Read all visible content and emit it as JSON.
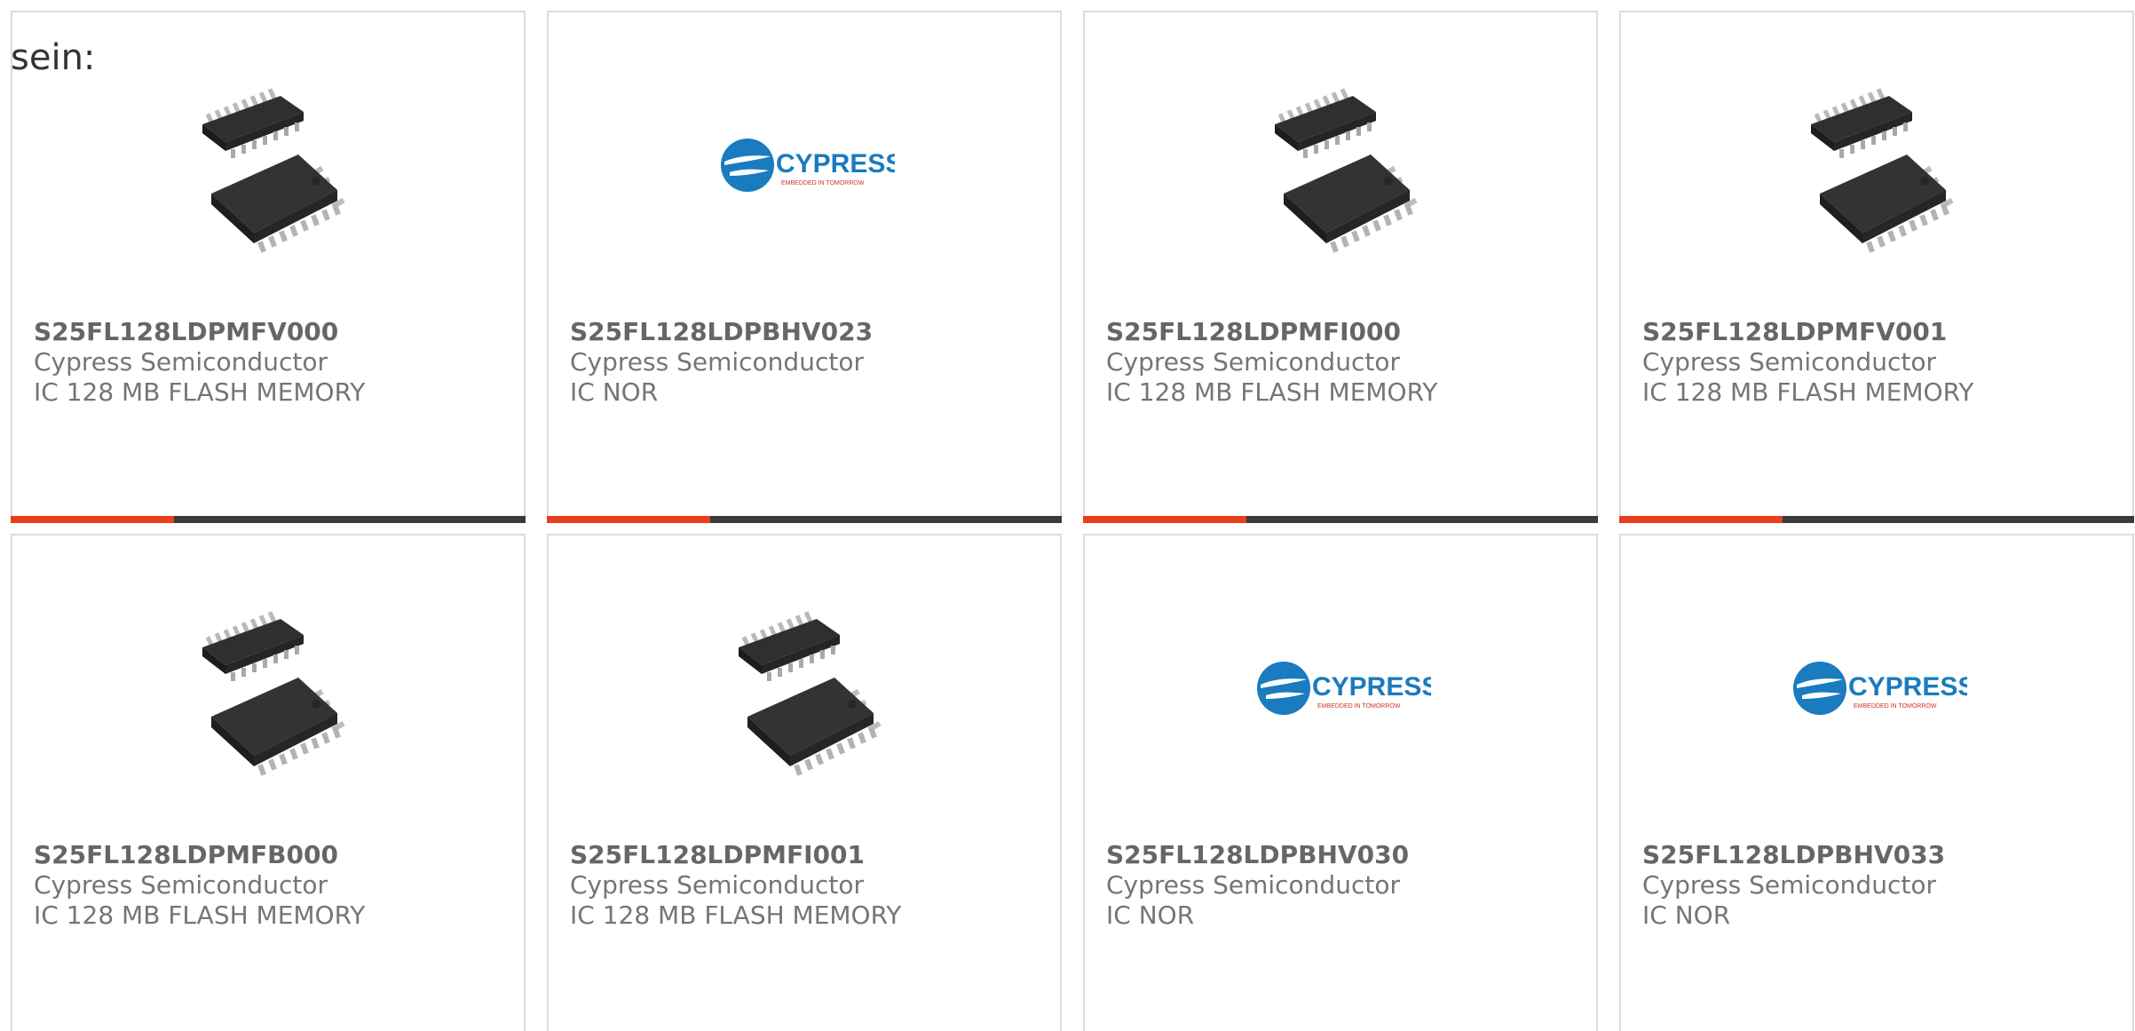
{
  "intro_text": "sein:",
  "colors": {
    "accent": "#e8401c",
    "bar": "#3a3a3a",
    "cypress_blue": "#1a7bbf",
    "cypress_red": "#d0312d"
  },
  "cypress_logo": {
    "wordmark": "CYPRESS",
    "tagline": "EMBEDDED IN TOMORROW"
  },
  "products": [
    {
      "part": "S25FL128LDPMFV000",
      "manufacturer": "Cypress Semiconductor",
      "description": "IC 128 MB FLASH MEMORY",
      "image": "chip"
    },
    {
      "part": "S25FL128LDPBHV023",
      "manufacturer": "Cypress Semiconductor",
      "description": "IC NOR",
      "image": "cypress-logo"
    },
    {
      "part": "S25FL128LDPMFI000",
      "manufacturer": "Cypress Semiconductor",
      "description": "IC 128 MB FLASH MEMORY",
      "image": "chip"
    },
    {
      "part": "S25FL128LDPMFV001",
      "manufacturer": "Cypress Semiconductor",
      "description": "IC 128 MB FLASH MEMORY",
      "image": "chip"
    },
    {
      "part": "S25FL128LDPMFB000",
      "manufacturer": "Cypress Semiconductor",
      "description": "IC 128 MB FLASH MEMORY",
      "image": "chip"
    },
    {
      "part": "S25FL128LDPMFI001",
      "manufacturer": "Cypress Semiconductor",
      "description": "IC 128 MB FLASH MEMORY",
      "image": "chip"
    },
    {
      "part": "S25FL128LDPBHV030",
      "manufacturer": "Cypress Semiconductor",
      "description": "IC NOR",
      "image": "cypress-logo"
    },
    {
      "part": "S25FL128LDPBHV033",
      "manufacturer": "Cypress Semiconductor",
      "description": "IC NOR",
      "image": "cypress-logo"
    }
  ]
}
